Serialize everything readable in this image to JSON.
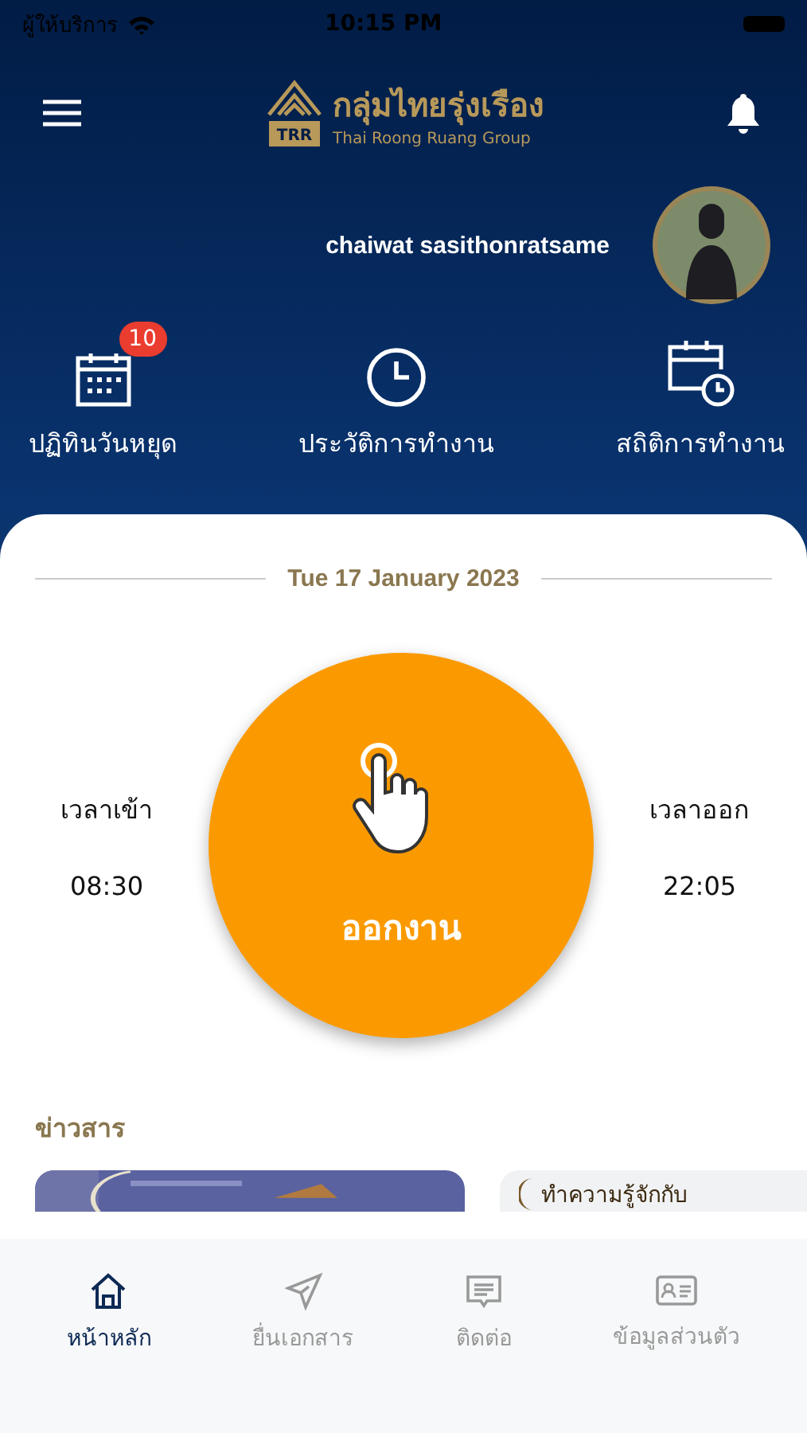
{
  "status_bar": {
    "carrier": "ผู้ให้บริการ",
    "time": "10:15 PM"
  },
  "header": {
    "logo_thai": "กลุ่มไทยรุ่งเรือง",
    "logo_english": "Thai Roong Ruang Group",
    "logo_mark": "TRR"
  },
  "user": {
    "name": "chaiwat  sasithonratsame"
  },
  "shortcuts": [
    {
      "kind": "calendar",
      "label": "ปฏิทินวันหยุด",
      "badge": "10"
    },
    {
      "kind": "clock",
      "label": "ประวัติการทำงาน"
    },
    {
      "kind": "stats",
      "label": "สถิติการทำงาน"
    }
  ],
  "date": "Tue 17 January 2023",
  "clock_in": {
    "label": "เวลาเข้า",
    "time": "08:30"
  },
  "clock_out": {
    "label": "เวลาออก",
    "time": "22:05"
  },
  "punch_button": {
    "label": "ออกงาน"
  },
  "news": {
    "title": "ข่าวสาร",
    "cards": [
      {
        "kind": "picture"
      },
      {
        "kind": "text",
        "caption": "ทำความรู้จักกับ"
      }
    ]
  },
  "tab_bar": [
    {
      "kind": "home",
      "label": "หน้าหลัก",
      "selected": true
    },
    {
      "kind": "send",
      "label": "ยื่นเอกสาร",
      "selected": false
    },
    {
      "kind": "message",
      "label": "ติดต่อ",
      "selected": false
    },
    {
      "kind": "profile",
      "label": "ข้อมูลส่วนตัว",
      "selected": false
    }
  ]
}
